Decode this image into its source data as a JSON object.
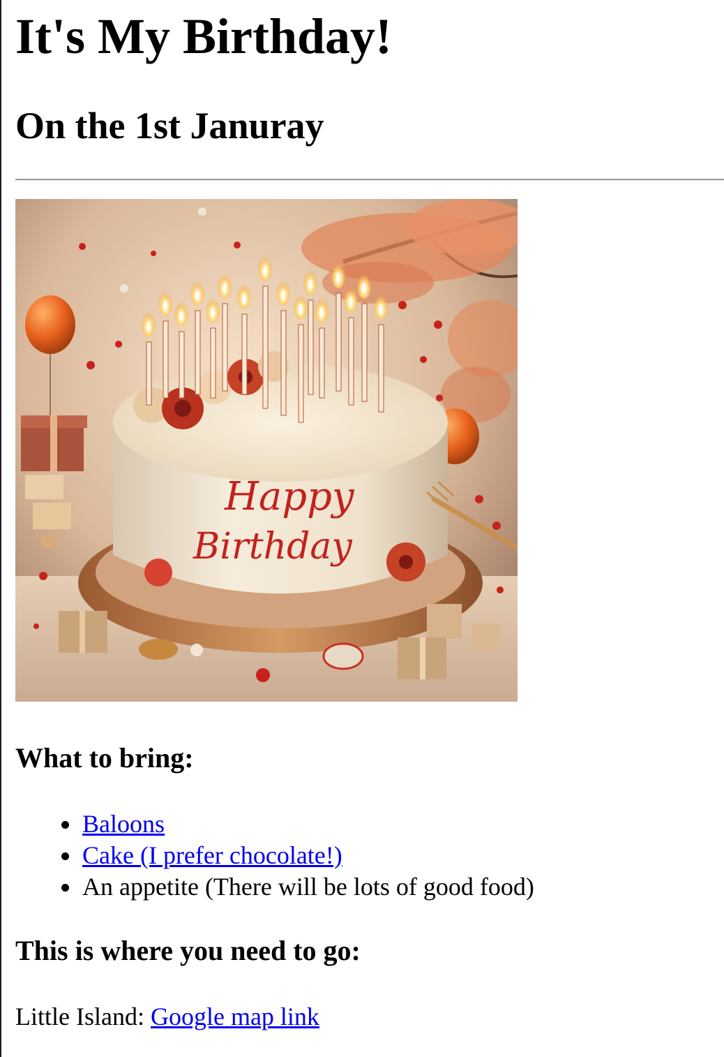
{
  "page": {
    "title": "It's My Birthday!",
    "subtitle": "On the 1st Januray"
  },
  "image": {
    "alt": "Happy Birthday cake",
    "cake_text_line1": "Happy",
    "cake_text_line2": "Birthday"
  },
  "bring_section": {
    "heading": "What to bring:",
    "items": [
      {
        "label": "Baloons",
        "is_link": true
      },
      {
        "label": "Cake (I prefer chocolate!)",
        "is_link": true
      },
      {
        "label": "An appetite (There will be lots of good food)",
        "is_link": false
      }
    ]
  },
  "location_section": {
    "heading": "This is where you need to go:",
    "place": "Little Island: ",
    "map_link_label": "Google map link"
  },
  "colors": {
    "link": "#0000ee",
    "text": "#000000",
    "rule": "#9a9a9a"
  }
}
